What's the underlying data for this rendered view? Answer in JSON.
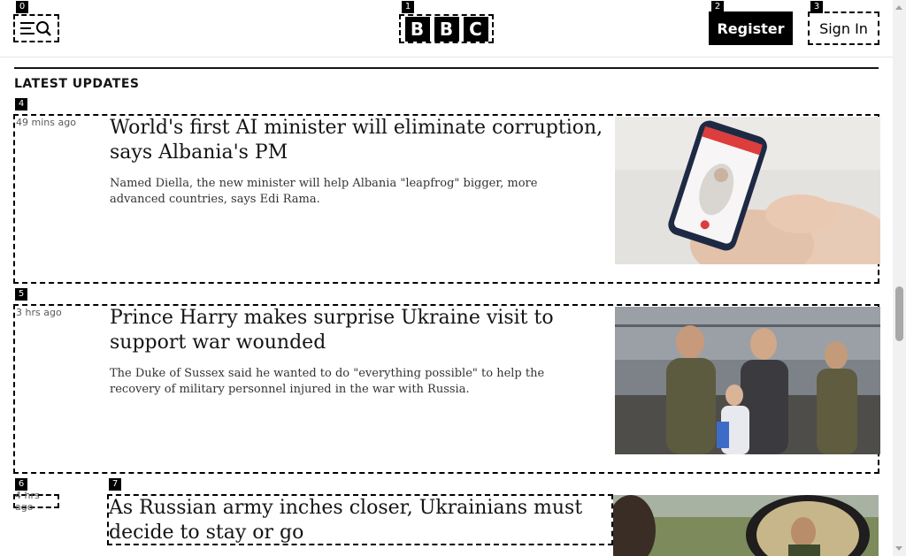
{
  "header": {
    "menu_icon": "menu-search-icon",
    "logo_letters": [
      "B",
      "B",
      "C"
    ],
    "register_label": "Register",
    "signin_label": "Sign In"
  },
  "tags": [
    "0",
    "1",
    "2",
    "3",
    "4",
    "5",
    "6",
    "7"
  ],
  "section": {
    "title": "LATEST UPDATES"
  },
  "articles": [
    {
      "time": "49 mins ago",
      "headline": "World's first AI minister will eliminate corruption, says Albania's PM",
      "summary": "Named Diella, the new minister will help Albania \"leapfrog\" bigger, more advanced countries, says Edi Rama."
    },
    {
      "time": "3 hrs ago",
      "headline": "Prince Harry makes surprise Ukraine visit to support war wounded",
      "summary": "The Duke of Sussex said he wanted to do \"everything possible\" to help the recovery of military personnel injured in the war with Russia."
    },
    {
      "time": "4 hrs ago",
      "headline": "As Russian army inches closer, Ukrainians must decide to stay or go",
      "summary": ""
    }
  ],
  "colors": {
    "brand": "#000000",
    "text": "#141414",
    "muted": "#5a5a5a"
  }
}
